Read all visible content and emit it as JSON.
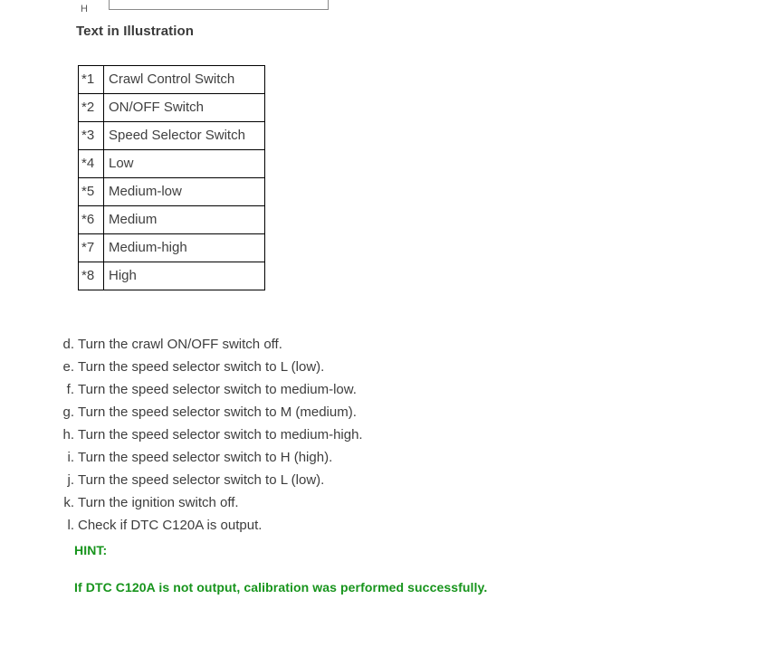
{
  "illustration": {
    "label": "H"
  },
  "section": {
    "heading": "Text in Illustration"
  },
  "legend": {
    "rows": [
      {
        "ref": "*1",
        "desc": "Crawl Control Switch"
      },
      {
        "ref": "*2",
        "desc": "ON/OFF Switch"
      },
      {
        "ref": "*3",
        "desc": "Speed Selector Switch"
      },
      {
        "ref": "*4",
        "desc": "Low"
      },
      {
        "ref": "*5",
        "desc": "Medium-low"
      },
      {
        "ref": "*6",
        "desc": "Medium"
      },
      {
        "ref": "*7",
        "desc": "Medium-high"
      },
      {
        "ref": "*8",
        "desc": "High"
      }
    ]
  },
  "steps": [
    {
      "marker": "d.",
      "text": "Turn the crawl ON/OFF switch off."
    },
    {
      "marker": "e.",
      "text": "Turn the speed selector switch to L (low)."
    },
    {
      "marker": "f.",
      "text": "Turn the speed selector switch to medium-low."
    },
    {
      "marker": "g.",
      "text": "Turn the speed selector switch to M (medium)."
    },
    {
      "marker": "h.",
      "text": "Turn the speed selector switch to medium-high."
    },
    {
      "marker": "i.",
      "text": "Turn the speed selector switch to H (high)."
    },
    {
      "marker": "j.",
      "text": "Turn the speed selector switch to L (low)."
    },
    {
      "marker": "k.",
      "text": "Turn the ignition switch off."
    },
    {
      "marker": "l.",
      "text": "Check if DTC C120A is output."
    }
  ],
  "hint": {
    "title": "HINT:",
    "body": "If DTC C120A is not output, calibration was performed successfully.",
    "color": "#17941c"
  }
}
